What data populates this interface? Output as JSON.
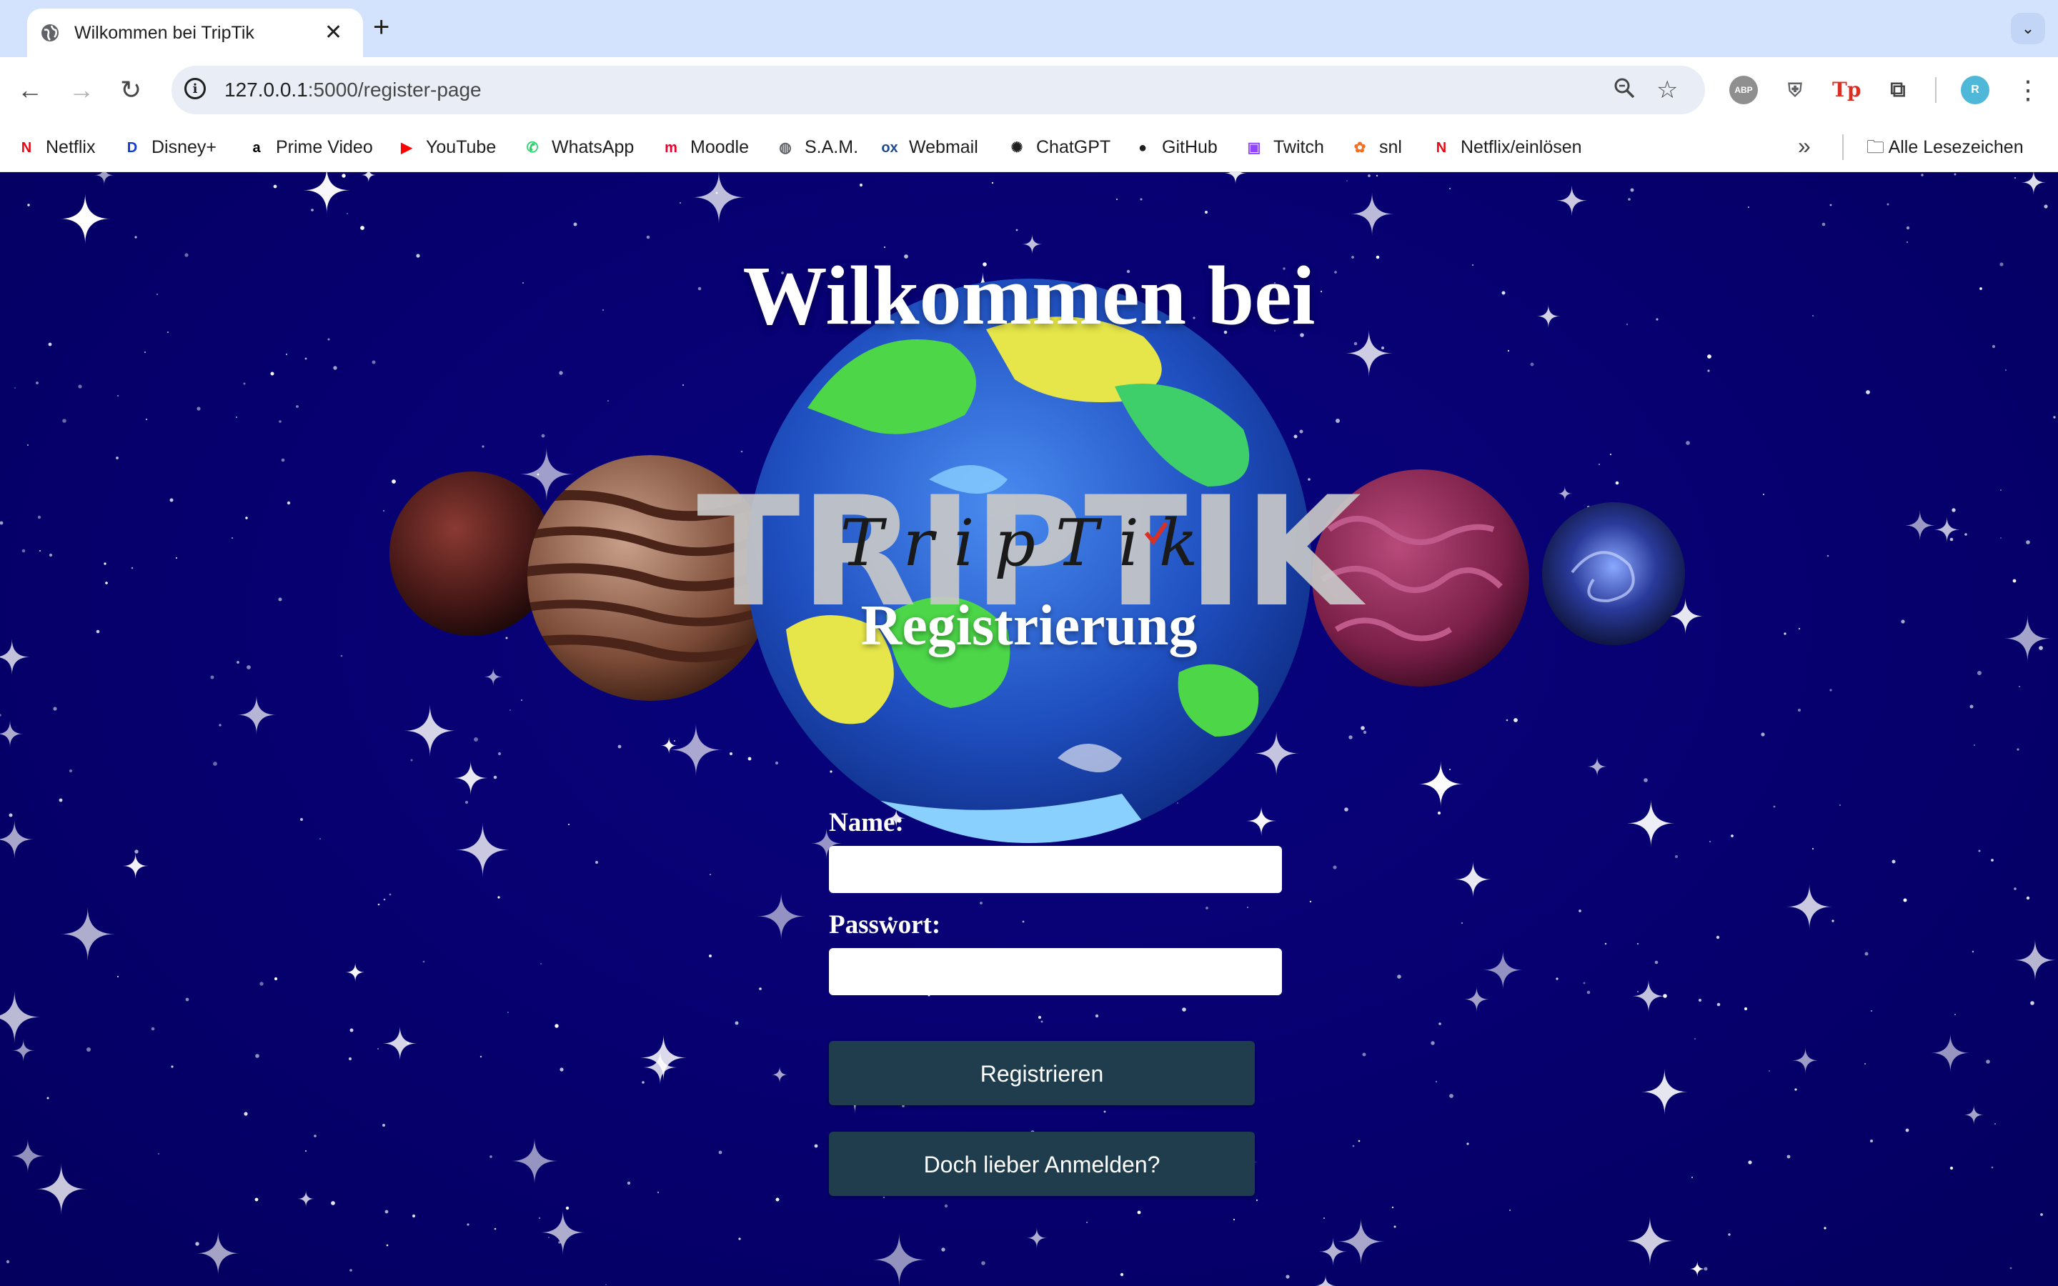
{
  "browser": {
    "tab_title": "Wilkommen bei TripTik",
    "url_host": "127.0.0.1",
    "url_path": ":5000/register-page",
    "profile_initial": "R",
    "bookmarks": [
      {
        "label": "Netflix",
        "icon": "netflix-icon",
        "color": "#e50914",
        "glyph": "N"
      },
      {
        "label": "Disney+",
        "icon": "disney-icon",
        "color": "#113ccf",
        "glyph": "D"
      },
      {
        "label": "Prime Video",
        "icon": "amazon-icon",
        "color": "#000000",
        "glyph": "a"
      },
      {
        "label": "YouTube",
        "icon": "youtube-icon",
        "color": "#ff0000",
        "glyph": "▶"
      },
      {
        "label": "WhatsApp",
        "icon": "whatsapp-icon",
        "color": "#25d366",
        "glyph": "✆"
      },
      {
        "label": "Moodle",
        "icon": "moodle-icon",
        "color": "#e4002b",
        "glyph": "m"
      },
      {
        "label": "S.A.M.",
        "icon": "globe-icon",
        "color": "#5f6368",
        "glyph": "◍"
      },
      {
        "label": "Webmail",
        "icon": "webmail-icon",
        "color": "#1e4b8f",
        "glyph": "ox"
      },
      {
        "label": "ChatGPT",
        "icon": "chatgpt-icon",
        "color": "#1f1f1f",
        "glyph": "✺"
      },
      {
        "label": "GitHub",
        "icon": "github-icon",
        "color": "#1f1f1f",
        "glyph": "●"
      },
      {
        "label": "Twitch",
        "icon": "twitch-icon",
        "color": "#9146ff",
        "glyph": "▣"
      },
      {
        "label": "snl",
        "icon": "nbc-peacock-icon",
        "color": "#f37021",
        "glyph": "✿"
      },
      {
        "label": "Netflix/einlösen",
        "icon": "netflix-icon",
        "color": "#e50914",
        "glyph": "N"
      }
    ],
    "all_bookmarks_label": "Alle Lesezeichen"
  },
  "page": {
    "welcome_heading": "Wilkommen bei",
    "logo_big_text": "TRIPTIK",
    "logo_script_text": "TripTik",
    "section_title": "Registrierung",
    "name_label": "Name:",
    "name_value": "",
    "password_label": "Passwort:",
    "password_value": "",
    "register_button": "Registrieren",
    "login_button": "Doch lieber Anmelden?"
  },
  "colors": {
    "page_background": "#05006b",
    "button_background": "#1f3d4c",
    "tabstrip": "#d3e3fd"
  }
}
